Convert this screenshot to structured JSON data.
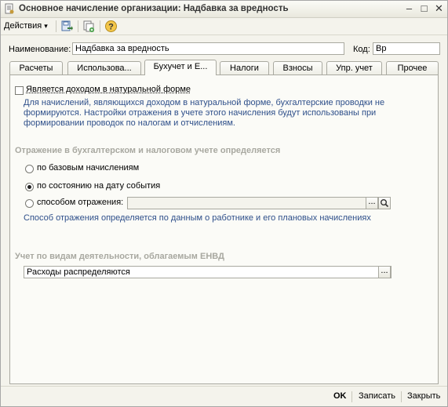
{
  "window": {
    "title": "Основное начисление организации: Надбавка за вредность"
  },
  "toolbar": {
    "actions_label": "Действия",
    "actions_arrow": "▾"
  },
  "form": {
    "name_label": "Наименование:",
    "name_value": "Надбавка за вредность",
    "code_label": "Код:",
    "code_value": "Вр"
  },
  "tabs": [
    {
      "label": "Расчеты"
    },
    {
      "label": "Использова..."
    },
    {
      "label": "Бухучет и Е..."
    },
    {
      "label": "Налоги"
    },
    {
      "label": "Взносы"
    },
    {
      "label": "Упр. учет"
    },
    {
      "label": "Прочее"
    }
  ],
  "active_tab": "Бухучет и Е...",
  "accounting": {
    "natural_income_label": "Является доходом в натуральной форме",
    "natural_income_checked": false,
    "natural_income_hint_1": "Для начислений, являющихся доходом в натуральной форме, бухгалтерские проводки не",
    "natural_income_hint_2": "формируются. Настройки отражения в учете этого начисления будут использованы при",
    "natural_income_hint_3": "формировании проводок по налогам и отчислениям.",
    "reflection_section": "Отражение в бухгалтерском и налоговом учете определяется",
    "radio_base": "по базовым начислениям",
    "radio_event_date": "по состоянию на дату события",
    "radio_method": "способом отражения:",
    "radio_selected": "по состоянию на дату события",
    "method_value": "",
    "method_hint": "Способ отражения определяется по данным о работнике и его плановых начислениях",
    "envd_section": "Учет по видам деятельности, облагаемым ЕНВД",
    "envd_value": "Расходы распределяются",
    "ellipsis": "...",
    "search_icon": "magnifier-icon"
  },
  "footer": {
    "ok_label": "OK",
    "save_label": "Записать",
    "close_label": "Закрыть"
  },
  "colors": {
    "hint_text": "#2e4f8a",
    "section_text": "#a8a8a0",
    "window_bg": "#f4f3ec"
  }
}
